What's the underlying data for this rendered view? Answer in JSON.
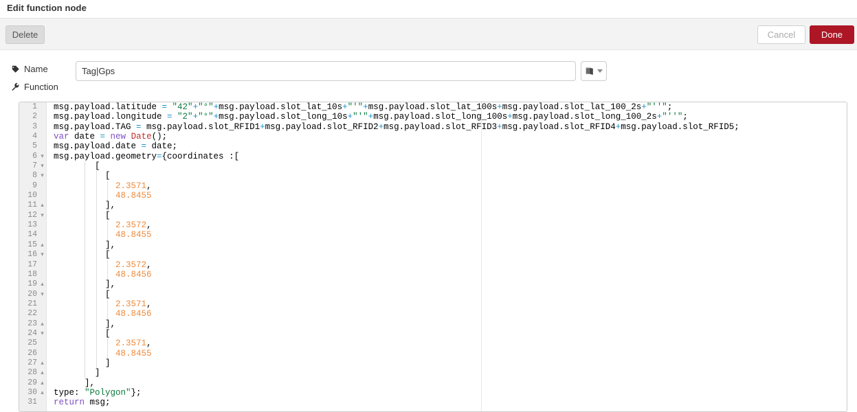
{
  "dialog": {
    "title": "Edit function node"
  },
  "toolbar": {
    "delete_label": "Delete",
    "cancel_label": "Cancel",
    "done_label": "Done",
    "done_color": "#ad1625"
  },
  "form": {
    "name_label": "Name",
    "name_icon": "tag-icon",
    "name_value": "Tag|Gps",
    "name_placeholder": "Name",
    "template_icon": "book-icon",
    "function_label": "Function",
    "function_icon": "wrench-icon"
  },
  "editor": {
    "language": "javascript",
    "total_lines": 31,
    "lines": [
      {
        "n": "1",
        "fold": "",
        "indent": 0,
        "tokens": [
          {
            "t": "msg.payload.latitude ",
            "c": "plain"
          },
          {
            "t": "= ",
            "c": "op"
          },
          {
            "t": "\"42\"",
            "c": "str"
          },
          {
            "t": "+",
            "c": "op"
          },
          {
            "t": "\"°\"",
            "c": "str"
          },
          {
            "t": "+",
            "c": "op"
          },
          {
            "t": "msg.payload.slot_lat_10s",
            "c": "plain"
          },
          {
            "t": "+",
            "c": "op"
          },
          {
            "t": "\"'\"",
            "c": "str"
          },
          {
            "t": "+",
            "c": "op"
          },
          {
            "t": "msg.payload.slot_lat_100s",
            "c": "plain"
          },
          {
            "t": "+",
            "c": "op"
          },
          {
            "t": "msg.payload.slot_lat_100_2s",
            "c": "plain"
          },
          {
            "t": "+",
            "c": "op"
          },
          {
            "t": "\"''\"",
            "c": "str"
          },
          {
            "t": ";",
            "c": "plain"
          }
        ]
      },
      {
        "n": "2",
        "fold": "",
        "indent": 0,
        "tokens": [
          {
            "t": "msg.payload.longitude ",
            "c": "plain"
          },
          {
            "t": "= ",
            "c": "op"
          },
          {
            "t": "\"2\"",
            "c": "str"
          },
          {
            "t": "+",
            "c": "op"
          },
          {
            "t": "\"°\"",
            "c": "str"
          },
          {
            "t": "+",
            "c": "op"
          },
          {
            "t": "msg.payload.slot_long_10s",
            "c": "plain"
          },
          {
            "t": "+",
            "c": "op"
          },
          {
            "t": "\"'\"",
            "c": "str"
          },
          {
            "t": "+",
            "c": "op"
          },
          {
            "t": "msg.payload.slot_long_100s",
            "c": "plain"
          },
          {
            "t": "+",
            "c": "op"
          },
          {
            "t": "msg.payload.slot_long_100_2s",
            "c": "plain"
          },
          {
            "t": "+",
            "c": "op"
          },
          {
            "t": "\"''\"",
            "c": "str"
          },
          {
            "t": ";",
            "c": "plain"
          }
        ]
      },
      {
        "n": "3",
        "fold": "",
        "indent": 0,
        "tokens": [
          {
            "t": "msg.payload.TAG ",
            "c": "plain"
          },
          {
            "t": "= ",
            "c": "op"
          },
          {
            "t": "msg.payload.slot_RFID1",
            "c": "plain"
          },
          {
            "t": "+",
            "c": "op"
          },
          {
            "t": "msg.payload.slot_RFID2",
            "c": "plain"
          },
          {
            "t": "+",
            "c": "op"
          },
          {
            "t": "msg.payload.slot_RFID3",
            "c": "plain"
          },
          {
            "t": "+",
            "c": "op"
          },
          {
            "t": "msg.payload.slot_RFID4",
            "c": "plain"
          },
          {
            "t": "+",
            "c": "op"
          },
          {
            "t": "msg.payload.slot_RFID5",
            "c": "plain"
          },
          {
            "t": ";",
            "c": "plain"
          }
        ]
      },
      {
        "n": "4",
        "fold": "",
        "indent": 0,
        "tokens": [
          {
            "t": "var ",
            "c": "kw"
          },
          {
            "t": "date ",
            "c": "plain"
          },
          {
            "t": "= ",
            "c": "op"
          },
          {
            "t": "new ",
            "c": "kw"
          },
          {
            "t": "Date",
            "c": "fn"
          },
          {
            "t": "();",
            "c": "plain"
          }
        ]
      },
      {
        "n": "5",
        "fold": "",
        "indent": 0,
        "tokens": [
          {
            "t": "msg.payload.date ",
            "c": "plain"
          },
          {
            "t": "= ",
            "c": "op"
          },
          {
            "t": "date;",
            "c": "plain"
          }
        ]
      },
      {
        "n": "6",
        "fold": "down",
        "indent": 0,
        "tokens": [
          {
            "t": "msg.payload.geometry",
            "c": "plain"
          },
          {
            "t": "=",
            "c": "op"
          },
          {
            "t": "{coordinates :[",
            "c": "plain"
          }
        ]
      },
      {
        "n": "7",
        "fold": "down",
        "indent": 1,
        "tokens": [
          {
            "t": "        [",
            "c": "plain"
          }
        ]
      },
      {
        "n": "8",
        "fold": "down",
        "indent": 2,
        "tokens": [
          {
            "t": "          [",
            "c": "plain"
          }
        ]
      },
      {
        "n": "9",
        "fold": "",
        "indent": 3,
        "tokens": [
          {
            "t": "            ",
            "c": "plain"
          },
          {
            "t": "2.3571",
            "c": "num"
          },
          {
            "t": ",",
            "c": "plain"
          }
        ]
      },
      {
        "n": "10",
        "fold": "",
        "indent": 3,
        "tokens": [
          {
            "t": "            ",
            "c": "plain"
          },
          {
            "t": "48.8455",
            "c": "num"
          }
        ]
      },
      {
        "n": "11",
        "fold": "up",
        "indent": 2,
        "tokens": [
          {
            "t": "          ],",
            "c": "plain"
          }
        ]
      },
      {
        "n": "12",
        "fold": "down",
        "indent": 2,
        "tokens": [
          {
            "t": "          [",
            "c": "plain"
          }
        ]
      },
      {
        "n": "13",
        "fold": "",
        "indent": 3,
        "tokens": [
          {
            "t": "            ",
            "c": "plain"
          },
          {
            "t": "2.3572",
            "c": "num"
          },
          {
            "t": ",",
            "c": "plain"
          }
        ]
      },
      {
        "n": "14",
        "fold": "",
        "indent": 3,
        "tokens": [
          {
            "t": "            ",
            "c": "plain"
          },
          {
            "t": "48.8455",
            "c": "num"
          }
        ]
      },
      {
        "n": "15",
        "fold": "up",
        "indent": 2,
        "tokens": [
          {
            "t": "          ],",
            "c": "plain"
          }
        ]
      },
      {
        "n": "16",
        "fold": "down",
        "indent": 2,
        "tokens": [
          {
            "t": "          [",
            "c": "plain"
          }
        ]
      },
      {
        "n": "17",
        "fold": "",
        "indent": 3,
        "tokens": [
          {
            "t": "            ",
            "c": "plain"
          },
          {
            "t": "2.3572",
            "c": "num"
          },
          {
            "t": ",",
            "c": "plain"
          }
        ]
      },
      {
        "n": "18",
        "fold": "",
        "indent": 3,
        "tokens": [
          {
            "t": "            ",
            "c": "plain"
          },
          {
            "t": "48.8456",
            "c": "num"
          }
        ]
      },
      {
        "n": "19",
        "fold": "up",
        "indent": 2,
        "tokens": [
          {
            "t": "          ],",
            "c": "plain"
          }
        ]
      },
      {
        "n": "20",
        "fold": "down",
        "indent": 2,
        "tokens": [
          {
            "t": "          [",
            "c": "plain"
          }
        ]
      },
      {
        "n": "21",
        "fold": "",
        "indent": 3,
        "tokens": [
          {
            "t": "            ",
            "c": "plain"
          },
          {
            "t": "2.3571",
            "c": "num"
          },
          {
            "t": ",",
            "c": "plain"
          }
        ]
      },
      {
        "n": "22",
        "fold": "",
        "indent": 3,
        "tokens": [
          {
            "t": "            ",
            "c": "plain"
          },
          {
            "t": "48.8456",
            "c": "num"
          }
        ]
      },
      {
        "n": "23",
        "fold": "up",
        "indent": 2,
        "tokens": [
          {
            "t": "          ],",
            "c": "plain"
          }
        ]
      },
      {
        "n": "24",
        "fold": "down",
        "indent": 2,
        "tokens": [
          {
            "t": "          [",
            "c": "plain"
          }
        ]
      },
      {
        "n": "25",
        "fold": "",
        "indent": 3,
        "tokens": [
          {
            "t": "            ",
            "c": "plain"
          },
          {
            "t": "2.3571",
            "c": "num"
          },
          {
            "t": ",",
            "c": "plain"
          }
        ]
      },
      {
        "n": "26",
        "fold": "",
        "indent": 3,
        "tokens": [
          {
            "t": "            ",
            "c": "plain"
          },
          {
            "t": "48.8455",
            "c": "num"
          }
        ]
      },
      {
        "n": "27",
        "fold": "up",
        "indent": 2,
        "tokens": [
          {
            "t": "          ]",
            "c": "plain"
          }
        ]
      },
      {
        "n": "28",
        "fold": "up",
        "indent": 1,
        "tokens": [
          {
            "t": "        ]",
            "c": "plain"
          }
        ]
      },
      {
        "n": "29",
        "fold": "up",
        "indent": 0,
        "tokens": [
          {
            "t": "      ],",
            "c": "plain"
          }
        ]
      },
      {
        "n": "30",
        "fold": "up",
        "indent": 0,
        "tokens": [
          {
            "t": "type: ",
            "c": "plain"
          },
          {
            "t": "\"Polygon\"",
            "c": "str"
          },
          {
            "t": "};",
            "c": "plain"
          }
        ]
      },
      {
        "n": "31",
        "fold": "",
        "indent": 0,
        "tokens": [
          {
            "t": "return ",
            "c": "kw"
          },
          {
            "t": "msg;",
            "c": "plain"
          }
        ]
      }
    ]
  },
  "colors": {
    "string": "#0b7b3e",
    "keyword": "#7d4fc4",
    "number": "#ed8b3d",
    "function": "#c42b2b",
    "operator": "#1c8fc9",
    "gutter_bg": "#f0f0f0",
    "toolbar_bg": "#f3f3f3"
  }
}
